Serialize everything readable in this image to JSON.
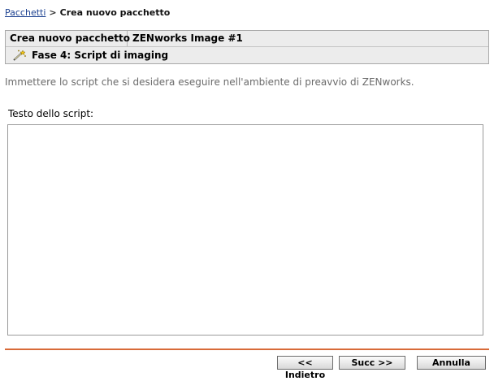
{
  "breadcrumb": {
    "link": "Pacchetti",
    "separator": ">",
    "current": "Crea nuovo pacchetto"
  },
  "header": {
    "label": "Crea nuovo pacchetto",
    "value": "ZENworks Image #1",
    "step_icon": "wand-icon",
    "step": "Fase 4: Script di imaging"
  },
  "instructions": "Immettere lo script che si desidera eseguire nell'ambiente di preavvio di ZENworks.",
  "script": {
    "label": "Testo dello script:",
    "value": ""
  },
  "buttons": {
    "back": "<< Indietro",
    "next": "Succ >>",
    "cancel": "Annulla"
  },
  "colors": {
    "divider": "#d86a38",
    "link": "#1a3f8f",
    "header_bg": "#ececec"
  }
}
